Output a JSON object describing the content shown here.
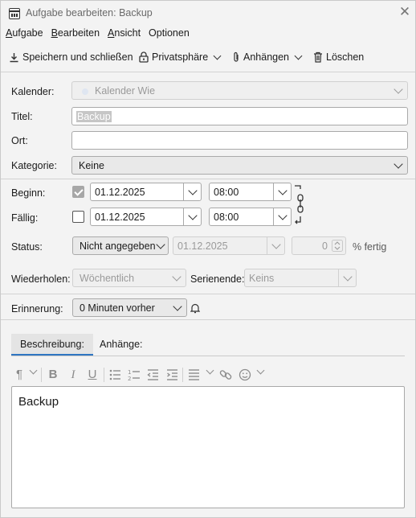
{
  "window": {
    "title": "Aufgabe bearbeiten: Backup"
  },
  "menu": [
    "Aufgabe",
    "Bearbeiten",
    "Ansicht",
    "Optionen"
  ],
  "toolbar": {
    "save_label": "Speichern und schließen",
    "privacy_label": "Privatsphäre",
    "attach_label": "Anhängen",
    "delete_label": "Löschen"
  },
  "form": {
    "calendar": {
      "label": "Kalender:",
      "value": "Kalender Wie"
    },
    "title": {
      "label": "Titel:",
      "value": "Backup"
    },
    "location": {
      "label": "Ort:",
      "value": ""
    },
    "category": {
      "label": "Kategorie:",
      "value": "Keine"
    },
    "start": {
      "label": "Beginn:",
      "checked": true,
      "date": "01.12.2025",
      "time": "08:00"
    },
    "due": {
      "label": "Fällig:",
      "checked": false,
      "date": "01.12.2025",
      "time": "08:00"
    },
    "status": {
      "label": "Status:",
      "value": "Nicht angegeben",
      "date": "01.12.2025",
      "percent": "0",
      "percent_suffix": "% fertig"
    },
    "repeat": {
      "label": "Wiederholen:",
      "value": "Wöchentlich",
      "end_label": "Serienende:",
      "end_value": "Keins"
    },
    "reminder": {
      "label": "Erinnerung:",
      "value": "0 Minuten vorher"
    }
  },
  "tabs": [
    {
      "label": "Beschreibung:",
      "active": true
    },
    {
      "label": "Anhänge:",
      "active": false
    }
  ],
  "description": {
    "text": "Backup"
  },
  "colors": {
    "accent": "#2f76c2",
    "window_bg": "#f3f3f3"
  }
}
